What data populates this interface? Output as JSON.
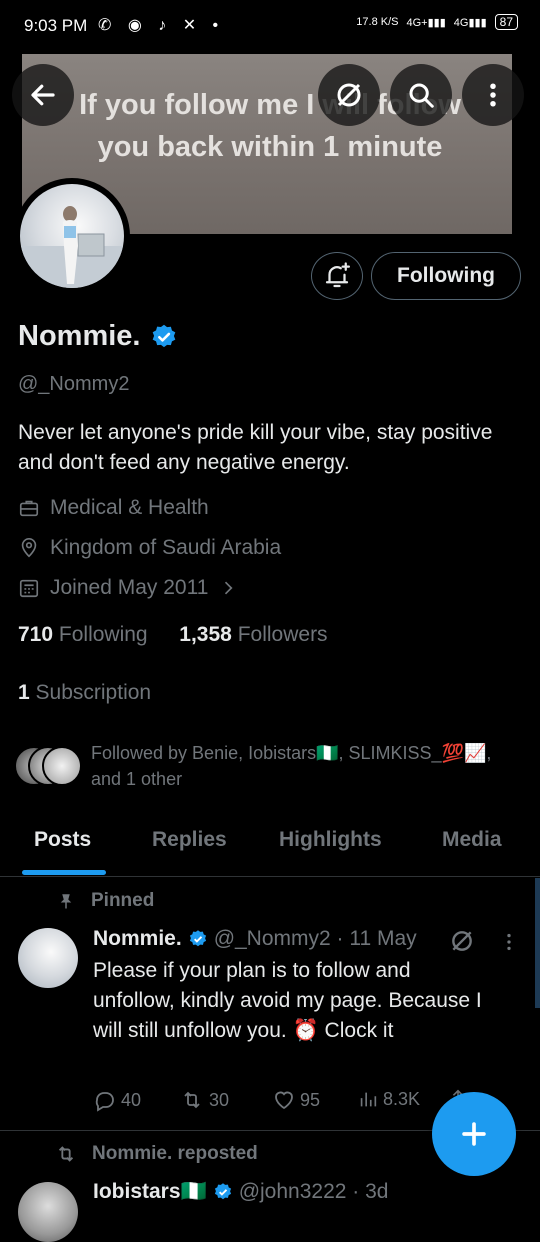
{
  "status_bar": {
    "time": "9:03 PM",
    "net_speed": "17.8 K/S",
    "signal1": "4G+",
    "signal2": "4G",
    "battery": "87"
  },
  "banner": {
    "text": "If you follow me I will follow you back within 1 minute"
  },
  "profile": {
    "follow_button": "Following",
    "name": "Nommie.",
    "handle": "@_Nommy2",
    "bio": "Never let anyone's pride kill your vibe, stay positive and don't feed any negative energy.",
    "category": "Medical & Health",
    "location": "Kingdom of Saudi Arabia",
    "joined": "Joined May 2011",
    "following_count": "710",
    "following_label": "Following",
    "followers_count": "1,358",
    "followers_label": "Followers",
    "subscription_count": "1",
    "subscription_label": "Subscription",
    "followed_by": "Followed by Benie, Iobistars🇳🇬, SLIMKISS_💯📈, and 1 other"
  },
  "tabs": [
    {
      "label": "Posts"
    },
    {
      "label": "Replies"
    },
    {
      "label": "Highlights"
    },
    {
      "label": "Media"
    }
  ],
  "pinned_post": {
    "pinned_label": "Pinned",
    "name": "Nommie.",
    "handle_date": "@_Nommy2 · 11 May",
    "text": "Please if your plan is to follow and unfollow, kindly avoid my page. Because I will still unfollow you. ⏰ Clock it",
    "replies": "40",
    "reposts": "30",
    "likes": "95",
    "views": "8.3K"
  },
  "repost": {
    "label": "Nommie. reposted",
    "name": "Iobistars🇳🇬",
    "handle_date": "@john3222 · 3d"
  },
  "colors": {
    "accent": "#1d9bf0",
    "muted": "#71767b",
    "text": "#e7e9ea",
    "border": "#536471"
  }
}
